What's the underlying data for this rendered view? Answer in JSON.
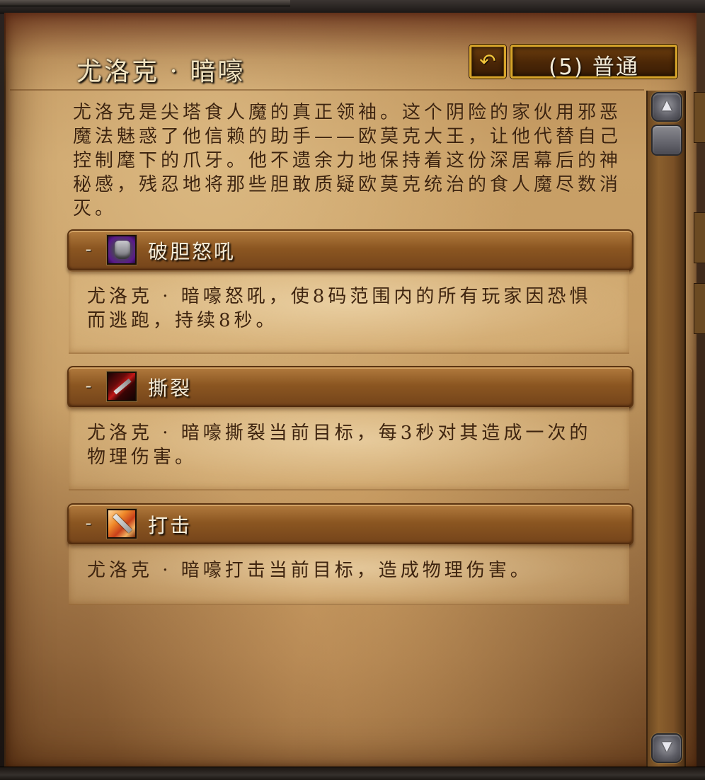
{
  "header": {
    "title": "尤洛克 · 暗嚎",
    "reset_icon": "reset-arrow-icon",
    "difficulty_label": "(5) 普通"
  },
  "intro": "尤洛克是尖塔食人魔的真正领袖。这个阴险的家伙用邪恶魔法魅惑了他信赖的助手——欧莫克大王，让他代替自己控制麾下的爪牙。他不遗余力地保持着这份深居幕后的神秘感，残忍地将那些胆敢质疑欧莫克统治的食人魔尽数消灭。",
  "abilities": [
    {
      "toggle": "-",
      "icon": "fear-shout-icon",
      "name": "破胆怒吼",
      "description": "尤洛克 · 暗嚎怒吼，使8码范围内的所有玩家因恐惧而逃跑，持续8秒。"
    },
    {
      "toggle": "-",
      "icon": "rend-icon",
      "name": "撕裂",
      "description": "尤洛克 · 暗嚎撕裂当前目标，每3秒对其造成一次的物理伤害。"
    },
    {
      "toggle": "-",
      "icon": "strike-icon",
      "name": "打击",
      "description": "尤洛克 · 暗嚎打击当前目标，造成物理伤害。"
    }
  ],
  "scrollbar": {
    "up_icon": "scroll-up-icon",
    "down_icon": "scroll-down-icon",
    "position": 0.0
  },
  "colors": {
    "parchment": "#c49a62",
    "text": "#3e240f",
    "header_text": "#f4ecd8",
    "gold_border": "#d6a42a"
  }
}
